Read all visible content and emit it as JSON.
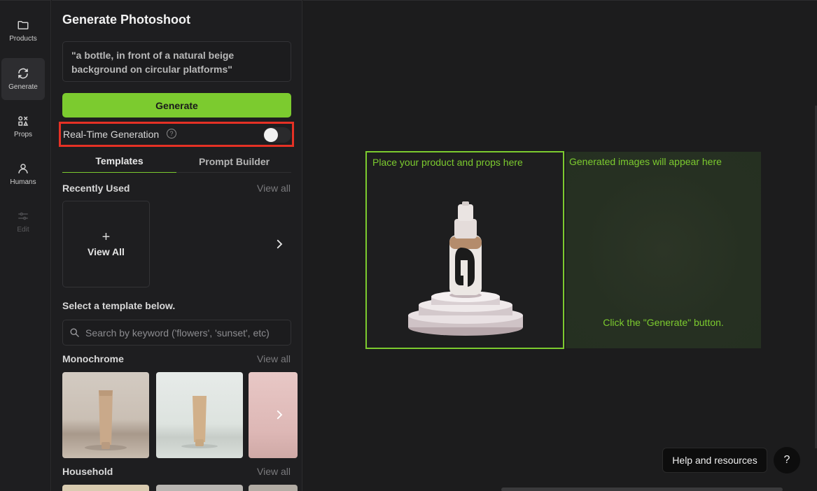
{
  "rail": {
    "items": [
      {
        "label": "Products",
        "icon": "folder-icon"
      },
      {
        "label": "Generate",
        "icon": "refresh-icon"
      },
      {
        "label": "Props",
        "icon": "props-icon"
      },
      {
        "label": "Humans",
        "icon": "person-icon"
      },
      {
        "label": "Edit",
        "icon": "sliders-icon"
      }
    ]
  },
  "panel": {
    "title": "Generate Photoshoot",
    "prompt": "\"a bottle, in front of a natural beige background on circular platforms\"",
    "generate_label": "Generate",
    "realtime_label": "Real-Time Generation",
    "realtime_help": "?",
    "realtime_on": false,
    "tabs": [
      {
        "label": "Templates"
      },
      {
        "label": "Prompt Builder"
      }
    ],
    "recently_used": {
      "title": "Recently Used",
      "view_all": "View all",
      "card_plus": "+",
      "card_label": "View All"
    },
    "select_hint": "Select a template below.",
    "search_placeholder": "Search by keyword ('flowers', 'sunset', etc)",
    "monochrome": {
      "title": "Monochrome",
      "view_all": "View all"
    },
    "household": {
      "title": "Household",
      "view_all": "View all"
    }
  },
  "canvas": {
    "drop_label": "Place your product and props here",
    "result_label": "Generated images will appear here",
    "result_hint": "Click the \"Generate\" button.",
    "help_label": "Help and resources",
    "help_q": "?"
  },
  "colors": {
    "accent": "#7ccb2f",
    "highlight": "#e53125"
  }
}
